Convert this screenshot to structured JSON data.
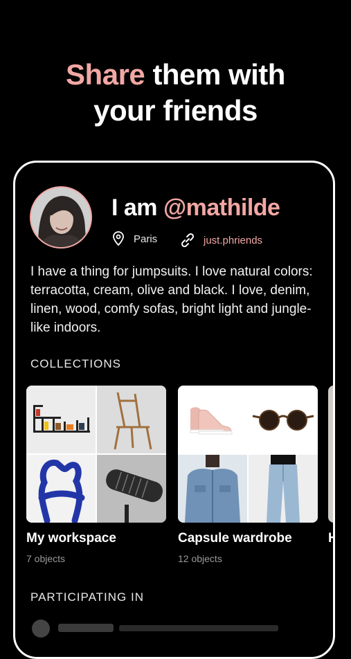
{
  "headline": {
    "accent": "Share",
    "rest": " them with",
    "line2": "your friends"
  },
  "profile": {
    "prefix": "I am ",
    "handle": "@mathilde",
    "location": "Paris",
    "link": "just.phriends",
    "bio": "I have a thing for jumpsuits. I love natural colors: terracotta, cream, olive and black. I love, denim, linen, wood, comfy sofas, bright light and jungle-like indoors."
  },
  "collections": {
    "heading": "COLLECTIONS",
    "items": [
      {
        "name": "My workspace",
        "count": "7 objects"
      },
      {
        "name": "Capsule wardrobe",
        "count": "12 objects"
      },
      {
        "name": "H"
      }
    ]
  },
  "participating": {
    "heading": "PARTICIPATING IN"
  },
  "colors": {
    "accent": "#f2a7a4",
    "background": "#000000",
    "text": "#ffffff",
    "muted": "#9a9a9a"
  },
  "icons": {
    "location": "location-pin-icon",
    "link": "link-icon"
  }
}
